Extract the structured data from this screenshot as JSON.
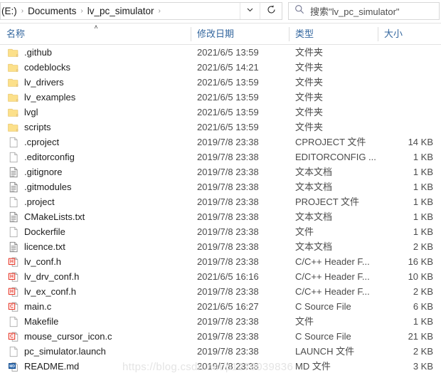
{
  "window": {
    "title": "lv_pc_simulator"
  },
  "addressbar": {
    "crumbs": [
      {
        "label": "(E:)",
        "clipped": true
      },
      {
        "label": "Documents",
        "clipped": false
      },
      {
        "label": "lv_pc_simulator",
        "clipped": false
      }
    ],
    "separator": "›",
    "dropdown_icon": "chevron-down-icon",
    "refresh_icon": "refresh-icon"
  },
  "search": {
    "icon": "search-icon",
    "placeholder": "搜索\"lv_pc_simulator\""
  },
  "columns": {
    "name": "名称",
    "date": "修改日期",
    "type": "类型",
    "size": "大小",
    "sort_indicator": "˄"
  },
  "files": [
    {
      "name": ".github",
      "icon": "folder-icon",
      "date": "2021/6/5 13:59",
      "type": "文件夹",
      "size": ""
    },
    {
      "name": "codeblocks",
      "icon": "folder-icon",
      "date": "2021/6/5 14:21",
      "type": "文件夹",
      "size": ""
    },
    {
      "name": "lv_drivers",
      "icon": "folder-icon",
      "date": "2021/6/5 13:59",
      "type": "文件夹",
      "size": ""
    },
    {
      "name": "lv_examples",
      "icon": "folder-icon",
      "date": "2021/6/5 13:59",
      "type": "文件夹",
      "size": ""
    },
    {
      "name": "lvgl",
      "icon": "folder-icon",
      "date": "2021/6/5 13:59",
      "type": "文件夹",
      "size": ""
    },
    {
      "name": "scripts",
      "icon": "folder-icon",
      "date": "2021/6/5 13:59",
      "type": "文件夹",
      "size": ""
    },
    {
      "name": ".cproject",
      "icon": "blank-file-icon",
      "date": "2019/7/8 23:38",
      "type": "CPROJECT 文件",
      "size": "14 KB"
    },
    {
      "name": ".editorconfig",
      "icon": "blank-file-icon",
      "date": "2019/7/8 23:38",
      "type": "EDITORCONFIG ...",
      "size": "1 KB"
    },
    {
      "name": ".gitignore",
      "icon": "text-file-icon",
      "date": "2019/7/8 23:38",
      "type": "文本文档",
      "size": "1 KB"
    },
    {
      "name": ".gitmodules",
      "icon": "text-file-icon",
      "date": "2019/7/8 23:38",
      "type": "文本文档",
      "size": "1 KB"
    },
    {
      "name": ".project",
      "icon": "blank-file-icon",
      "date": "2019/7/8 23:38",
      "type": "PROJECT 文件",
      "size": "1 KB"
    },
    {
      "name": "CMakeLists.txt",
      "icon": "text-file-icon",
      "date": "2019/7/8 23:38",
      "type": "文本文档",
      "size": "1 KB"
    },
    {
      "name": "Dockerfile",
      "icon": "blank-file-icon",
      "date": "2019/7/8 23:38",
      "type": "文件",
      "size": "1 KB"
    },
    {
      "name": "licence.txt",
      "icon": "text-file-icon",
      "date": "2019/7/8 23:38",
      "type": "文本文档",
      "size": "2 KB"
    },
    {
      "name": "lv_conf.h",
      "icon": "header-file-icon",
      "date": "2019/7/8 23:38",
      "type": "C/C++ Header F...",
      "size": "16 KB"
    },
    {
      "name": "lv_drv_conf.h",
      "icon": "header-file-icon",
      "date": "2021/6/5 16:16",
      "type": "C/C++ Header F...",
      "size": "10 KB"
    },
    {
      "name": "lv_ex_conf.h",
      "icon": "header-file-icon",
      "date": "2019/7/8 23:38",
      "type": "C/C++ Header F...",
      "size": "2 KB"
    },
    {
      "name": "main.c",
      "icon": "c-source-icon",
      "date": "2021/6/5 16:27",
      "type": "C Source File",
      "size": "6 KB"
    },
    {
      "name": "Makefile",
      "icon": "blank-file-icon",
      "date": "2019/7/8 23:38",
      "type": "文件",
      "size": "1 KB"
    },
    {
      "name": "mouse_cursor_icon.c",
      "icon": "c-source-icon",
      "date": "2019/7/8 23:38",
      "type": "C Source File",
      "size": "21 KB"
    },
    {
      "name": "pc_simulator.launch",
      "icon": "blank-file-icon",
      "date": "2019/7/8 23:38",
      "type": "LAUNCH 文件",
      "size": "2 KB"
    },
    {
      "name": "README.md",
      "icon": "md-file-icon",
      "date": "2019/7/8 23:38",
      "type": "MD 文件",
      "size": "3 KB"
    }
  ],
  "watermark": {
    "left": "https://blog.csdn.net/p1279039836",
    "right": "279039836"
  },
  "colors": {
    "folder": "#fce08a",
    "folder_edge": "#e8c468",
    "header_text": "#33669e",
    "header_icon_red": "#e8392a",
    "md_icon_blue": "#1f5fa8",
    "body_text": "#1d1d1d"
  }
}
